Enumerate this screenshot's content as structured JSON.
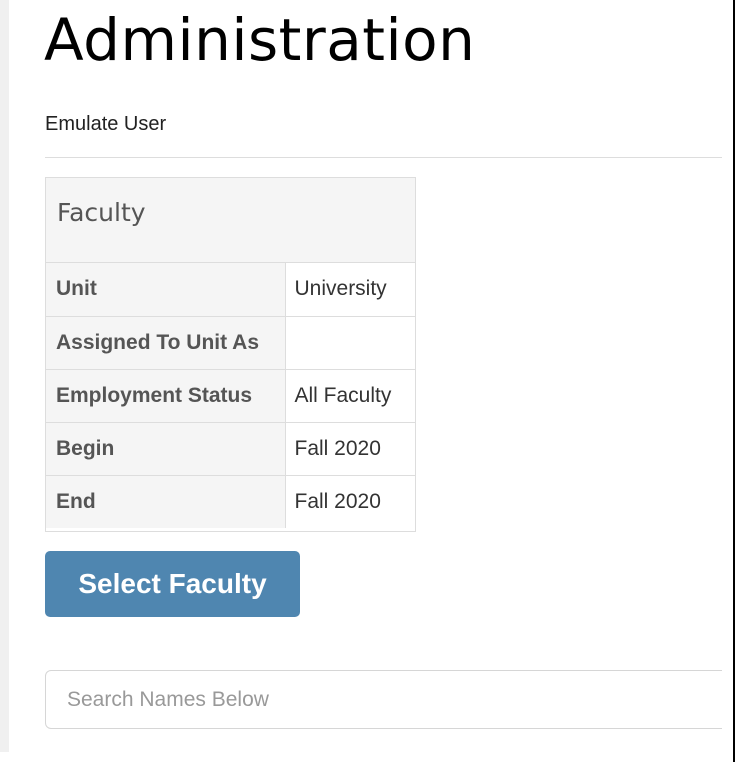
{
  "header": {
    "title": "Administration"
  },
  "subnav": {
    "emulate_user_label": "Emulate User"
  },
  "panel": {
    "heading": "Faculty",
    "rows": [
      {
        "label": "Unit",
        "value": "University"
      },
      {
        "label": "Assigned To Unit As",
        "value": ""
      },
      {
        "label": "Employment Status",
        "value": "All Faculty"
      },
      {
        "label": "Begin",
        "value": "Fall 2020"
      },
      {
        "label": "End",
        "value": "Fall 2020"
      }
    ]
  },
  "actions": {
    "select_faculty_label": "Select Faculty"
  },
  "search": {
    "placeholder": "Search Names Below",
    "value": ""
  },
  "colors": {
    "button": "#4f86b0",
    "panel_heading_bg": "#f5f5f5",
    "border": "#dddddd"
  }
}
